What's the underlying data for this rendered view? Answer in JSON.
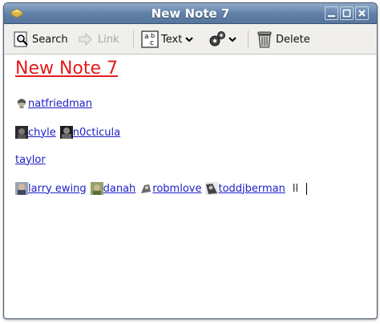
{
  "window": {
    "title": "New Note 7"
  },
  "toolbar": {
    "search_label": "Search",
    "link_label": "Link",
    "text_label": "Text",
    "delete_label": "Delete"
  },
  "note": {
    "title": "New Note 7",
    "lines": [
      [
        "natfriedman"
      ],
      [
        "chyle",
        "n0cticula"
      ],
      [
        "taylor"
      ],
      [
        "larry ewing",
        "danah",
        "robmlove",
        "toddjberman"
      ]
    ],
    "trailing_text": "ll"
  },
  "colors": {
    "title_red": "#e41b1b",
    "link_blue": "#1f20c8",
    "titlebar": "#5f7fa6"
  }
}
